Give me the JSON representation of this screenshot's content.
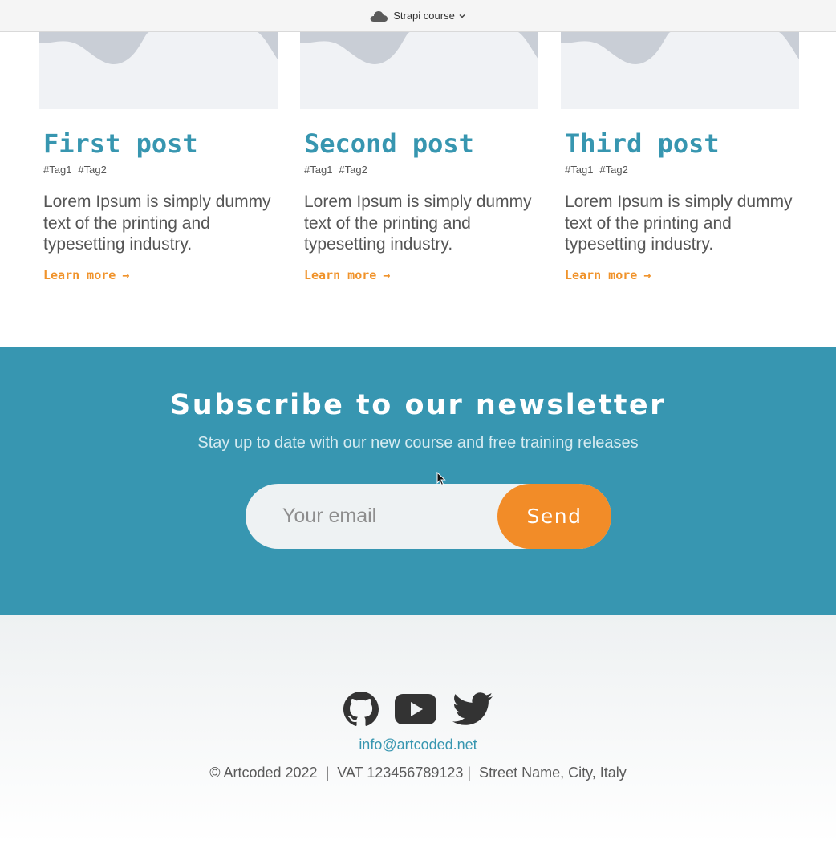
{
  "browser": {
    "tab_title": "Strapi course",
    "cloud_icon": "cloud-icon",
    "chevron_icon": "chevron-down-icon"
  },
  "posts": [
    {
      "title": "First post",
      "tags": [
        "#Tag1",
        "#Tag2"
      ],
      "description": "Lorem Ipsum is simply dummy text of the printing and typesetting industry.",
      "link_label": "Learn more",
      "link_arrow": "→"
    },
    {
      "title": "Second post",
      "tags": [
        "#Tag1",
        "#Tag2"
      ],
      "description": "Lorem Ipsum is simply dummy text of the printing and typesetting industry.",
      "link_label": "Learn more",
      "link_arrow": "→"
    },
    {
      "title": "Third post",
      "tags": [
        "#Tag1",
        "#Tag2"
      ],
      "description": "Lorem Ipsum is simply dummy text of the printing and typesetting industry.",
      "link_label": "Learn more",
      "link_arrow": "→"
    }
  ],
  "newsletter": {
    "heading": "Subscribe to our newsletter",
    "subheading": "Stay up to date with our new course and free training releases",
    "email_placeholder": "Your email",
    "send_label": "Send",
    "background_color": "#3796b1",
    "button_color": "#f28c28"
  },
  "footer": {
    "social_icons": [
      "github-icon",
      "youtube-icon",
      "twitter-icon"
    ],
    "email": "info@artcoded.net",
    "legal": "© Artcoded 2022  |  VAT 123456789123 |  Street Name, City, Italy"
  },
  "colors": {
    "accent": "#3796b0",
    "link": "#f0932b",
    "text": "#555555"
  }
}
